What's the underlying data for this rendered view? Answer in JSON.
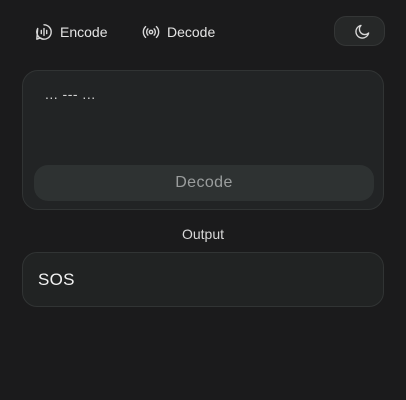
{
  "nav": {
    "encode": {
      "label": "Encode",
      "icon": "audio-waveform-icon"
    },
    "decode": {
      "label": "Decode",
      "icon": "radio-broadcast-icon"
    }
  },
  "theme_toggle": {
    "icon": "moon-icon"
  },
  "input": {
    "value": "... --- ..."
  },
  "decode_button": {
    "label": "Decode"
  },
  "output": {
    "label": "Output",
    "value": "SOS"
  },
  "colors": {
    "background": "#1b1b1c",
    "card": "#222425",
    "button": "#2e3232",
    "text": "#e6e6e6"
  }
}
